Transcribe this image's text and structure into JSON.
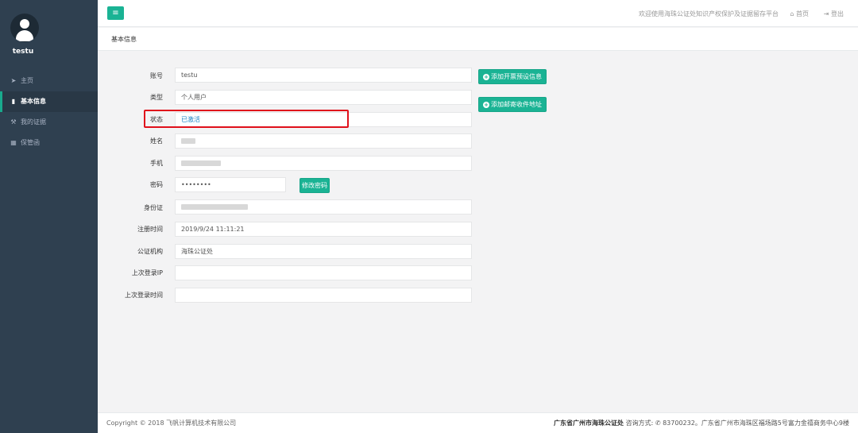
{
  "sidebar": {
    "username": "testu",
    "items": [
      {
        "icon": "paper-plane-icon",
        "glyph": "➤",
        "label": "主页"
      },
      {
        "icon": "id-card-icon",
        "glyph": "▮",
        "label": "基本信息"
      },
      {
        "icon": "gavel-icon",
        "glyph": "⚒",
        "label": "我的证据"
      },
      {
        "icon": "table-icon",
        "glyph": "▦",
        "label": "保管函"
      }
    ]
  },
  "topbar": {
    "menu_glyph": "≡",
    "welcome": "欢迎使用海珠公证处知识产权保护及证据留存平台",
    "home_glyph": "⌂",
    "home": "首页",
    "logout_glyph": "⇥",
    "logout": "登出"
  },
  "page": {
    "title": "基本信息"
  },
  "form": {
    "account_label": "账号",
    "account_value": "testu",
    "type_label": "类型",
    "type_value": "个人用户",
    "status_label": "状态",
    "status_value": "已激活",
    "name_label": "姓名",
    "phone_label": "手机",
    "password_label": "密码",
    "password_value": "••••••••",
    "idcard_label": "身份证",
    "regtime_label": "注册时间",
    "regtime_value": "2019/9/24 11:11:21",
    "notary_label": "公证机构",
    "notary_value": "海珠公证处",
    "lastip_label": "上次登录IP",
    "lastip_value": "",
    "lasttime_label": "上次登录时间",
    "lasttime_value": ""
  },
  "buttons": {
    "change_password": "修改密码",
    "add_invoice": "添加开票预设信息",
    "add_address": "添加邮寄收件地址",
    "plus_glyph": "+"
  },
  "footer": {
    "copyright": "Copyright © 2018 飞帆计算机技术有限公司",
    "org": "广东省广州市海珠公证处",
    "contact_label": "咨询方式:",
    "phone_glyph": "✆",
    "contact": "83700232。广东省广州市海珠区福场路5号富力金禧商务中心9楼"
  },
  "colors": {
    "sidebar_bg": "#2f4050",
    "accent": "#1ab394",
    "highlight": "#e0101b",
    "status_text": "#1c84c6"
  }
}
